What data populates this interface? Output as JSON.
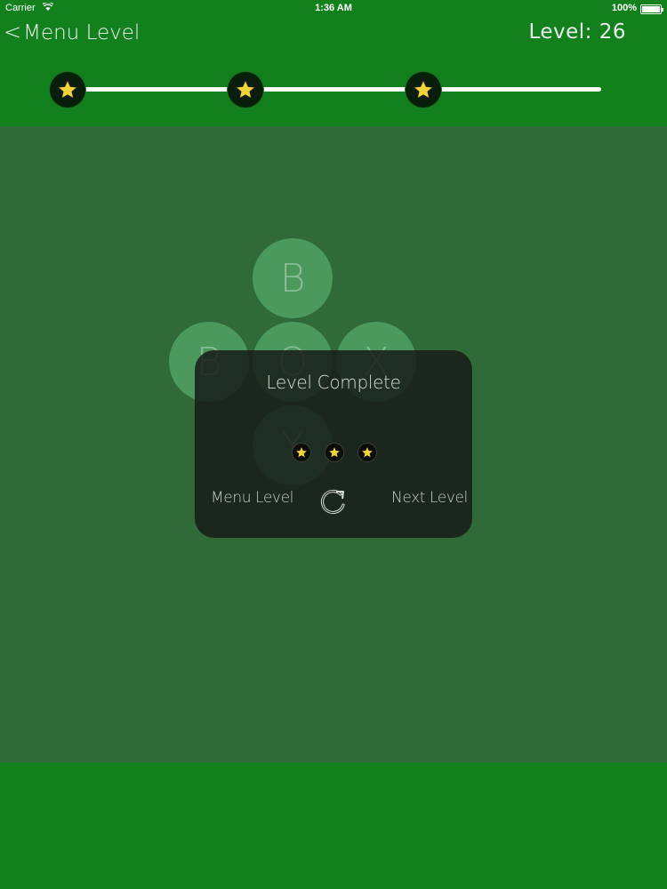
{
  "status_bar": {
    "carrier": "Carrier",
    "time": "1:36 AM",
    "battery": "100%"
  },
  "header": {
    "back_label": "Menu Level",
    "level_label": "Level: 26"
  },
  "progress": {
    "stars_earned": 3,
    "stars_total": 3
  },
  "board": {
    "tiles": [
      "B",
      "B",
      "O",
      "X",
      "Y"
    ]
  },
  "dialog": {
    "title": "Level Complete",
    "stars_earned": 3,
    "menu_label": "Menu Level",
    "next_label": "Next Level"
  },
  "colors": {
    "header_green": "#13801e",
    "board_green": "#2f6a38",
    "star_yellow": "#f2d43a"
  }
}
